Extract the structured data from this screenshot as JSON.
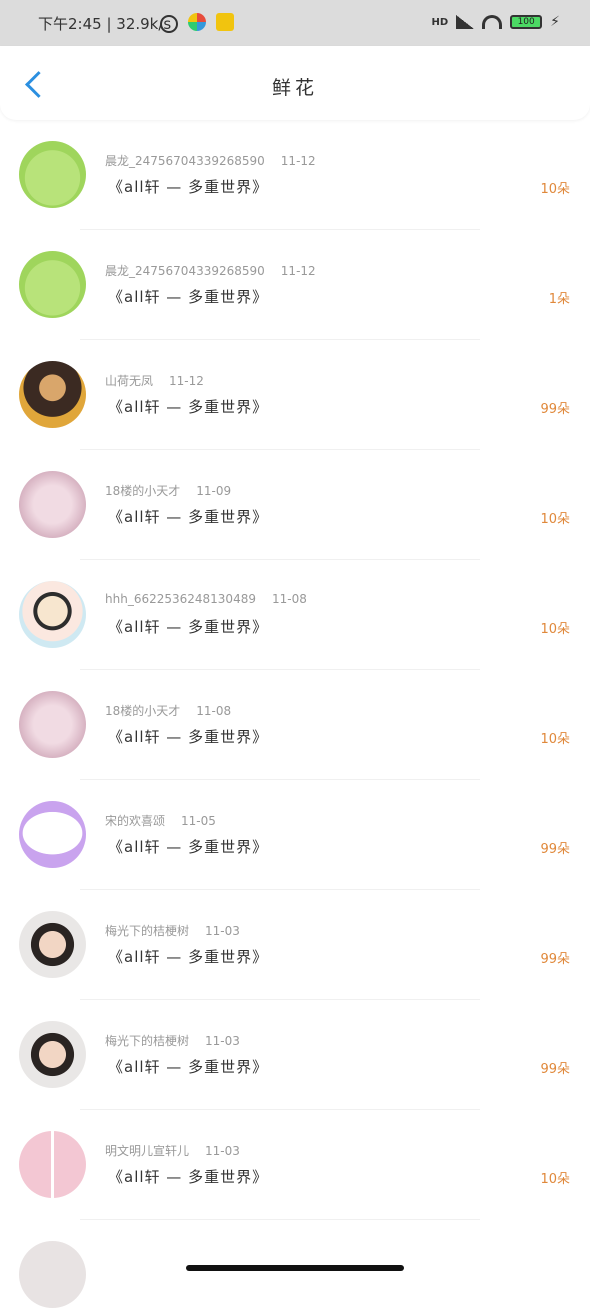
{
  "status_bar": {
    "time_speed": "下午2:45 | 32.9k/s",
    "network_label": "HD",
    "battery_text": "100"
  },
  "header": {
    "title": "鲜花"
  },
  "rows": [
    {
      "user": "晨龙_2475670433926859​0",
      "date": "11-12",
      "book": "《all轩 — 多重世界》",
      "quantity": "10朵",
      "avatar": "green-smiley-avatar"
    },
    {
      "user": "晨龙_24756704339268590",
      "date": "11-12",
      "book": "《all轩 — 多重世界》",
      "quantity": "1朵",
      "avatar": "green-smiley-avatar"
    },
    {
      "user": "山荷无凤",
      "date": "11-12",
      "book": "《all轩 — 多重世界》",
      "quantity": "99朵",
      "avatar": "person-avatar"
    },
    {
      "user": "18楼的小天才",
      "date": "11-09",
      "book": "《all轩 — 多重世界》",
      "quantity": "10朵",
      "avatar": "pink-text-avatar"
    },
    {
      "user": "hhh_66225362481304​89",
      "date": "11-08",
      "book": "《all轩 — 多重世界》",
      "quantity": "10朵",
      "avatar": "cartoon-boy-avatar"
    },
    {
      "user": "18楼的小天才",
      "date": "11-08",
      "book": "《all轩 — 多重世界》",
      "quantity": "10朵",
      "avatar": "pink-text-avatar"
    },
    {
      "user": "宋的欢喜颂",
      "date": "11-05",
      "book": "《all轩 — 多重世界》",
      "quantity": "99朵",
      "avatar": "chat-bubble-avatar"
    },
    {
      "user": "梅光下的桔梗树",
      "date": "11-03",
      "book": "《all轩 — 多重世界》",
      "quantity": "99朵",
      "avatar": "boy-photo-avatar"
    },
    {
      "user": "梅光下的桔梗树",
      "date": "11-03",
      "book": "《all轩 — 多重世界》",
      "quantity": "99朵",
      "avatar": "boy-photo-avatar"
    },
    {
      "user": "明文明儿宣轩儿",
      "date": "11-03",
      "book": "《all轩 — 多重世界》",
      "quantity": "10朵",
      "avatar": "two-people-avatar"
    }
  ]
}
